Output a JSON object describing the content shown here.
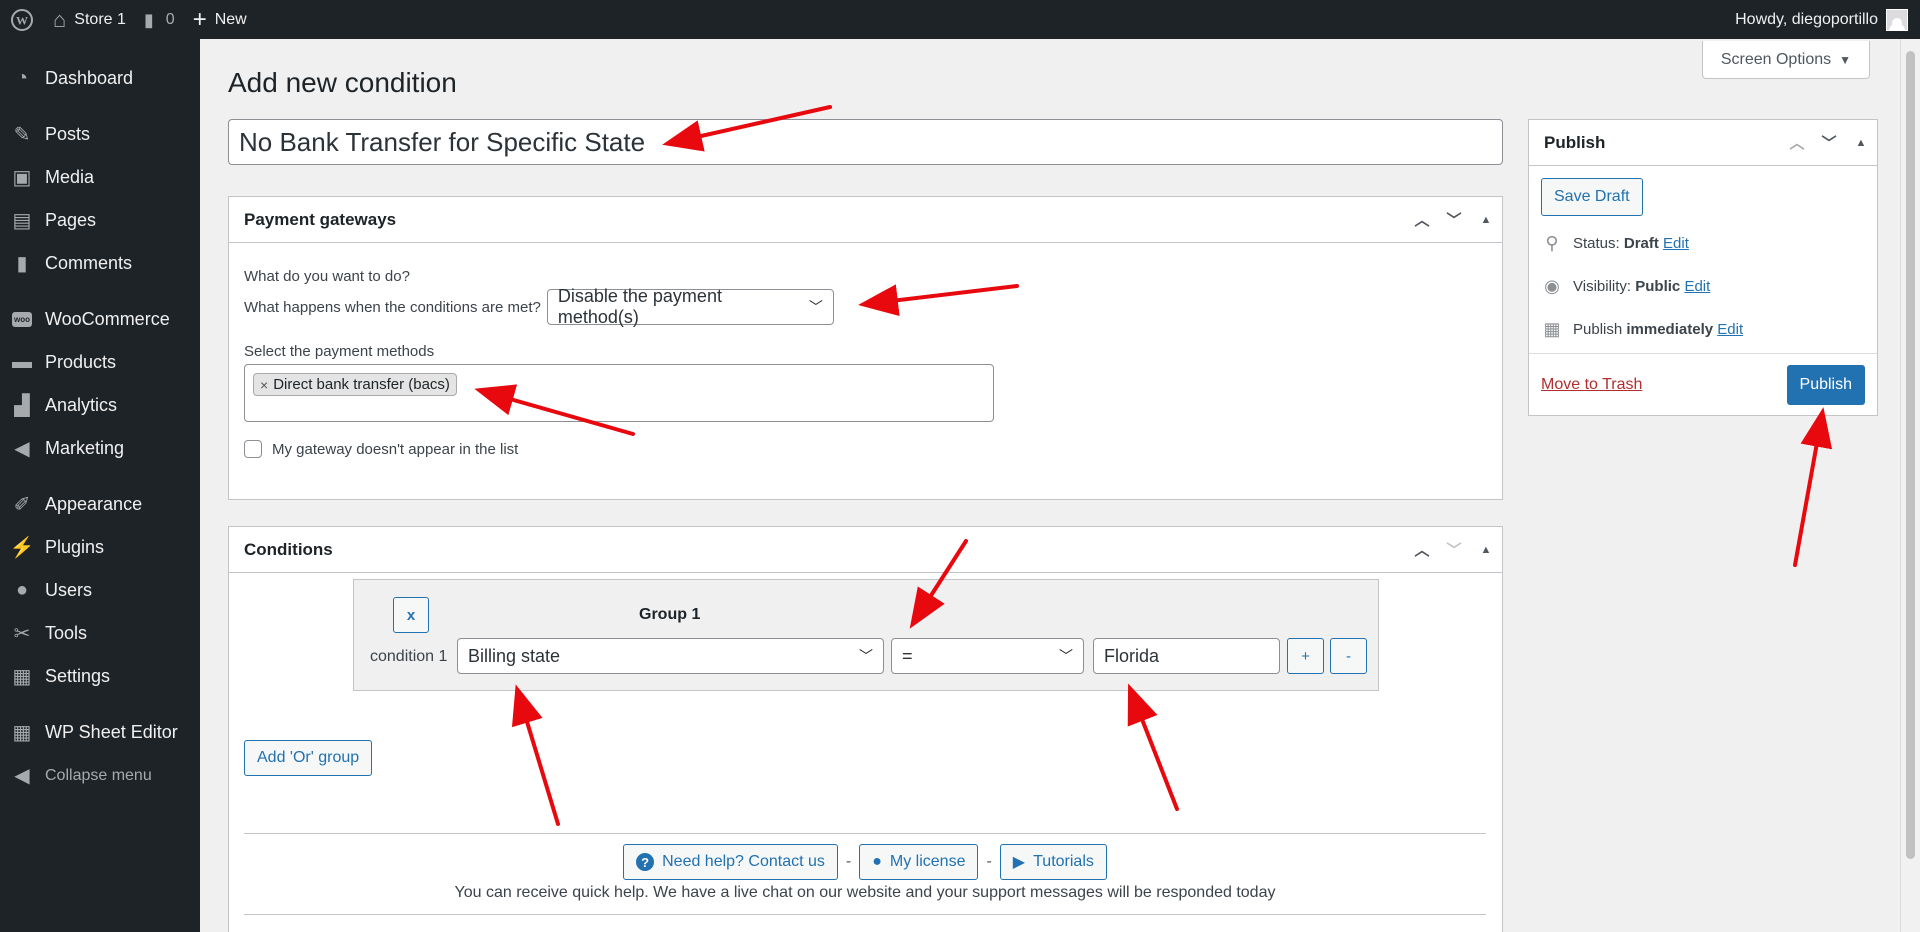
{
  "adminbar": {
    "site_name": "Store 1",
    "comments_count": "0",
    "new_label": "New",
    "howdy": "Howdy, diegoportillo"
  },
  "sidebar": {
    "items": [
      {
        "label": "Dashboard",
        "icon": "dashboard-icon"
      },
      {
        "label": "Posts",
        "icon": "pin-icon"
      },
      {
        "label": "Media",
        "icon": "media-icon"
      },
      {
        "label": "Pages",
        "icon": "pages-icon"
      },
      {
        "label": "Comments",
        "icon": "comments-icon"
      },
      {
        "label": "WooCommerce",
        "icon": "woo-icon"
      },
      {
        "label": "Products",
        "icon": "products-icon"
      },
      {
        "label": "Analytics",
        "icon": "analytics-icon"
      },
      {
        "label": "Marketing",
        "icon": "megaphone-icon"
      },
      {
        "label": "Appearance",
        "icon": "brush-icon"
      },
      {
        "label": "Plugins",
        "icon": "plugin-icon"
      },
      {
        "label": "Users",
        "icon": "user-icon"
      },
      {
        "label": "Tools",
        "icon": "wrench-icon"
      },
      {
        "label": "Settings",
        "icon": "settings-icon"
      },
      {
        "label": "WP Sheet Editor",
        "icon": "spreadsheet-icon"
      },
      {
        "label": "Collapse menu",
        "icon": "collapse-icon"
      }
    ]
  },
  "header": {
    "screen_options": "Screen Options",
    "page_title": "Add new condition"
  },
  "title_field": {
    "value": "No Bank Transfer for Specific State"
  },
  "payment_gateways": {
    "heading": "Payment gateways",
    "question": "What do you want to do?",
    "when_label": "What happens when the conditions are met?",
    "action_value": "Disable the payment method(s)",
    "select_label": "Select the payment methods",
    "token": "Direct bank transfer (bacs)",
    "checkbox_label": "My gateway doesn't appear in the list"
  },
  "conditions": {
    "heading": "Conditions",
    "group_title": "Group 1",
    "remove_group": "x",
    "condition_label": "condition 1",
    "field_value": "Billing state",
    "operator_value": "=",
    "value": "Florida",
    "plus": "+",
    "minus": "-",
    "add_or_group": "Add 'Or' group",
    "help_button": "Need help? Contact us",
    "license_button": "My license",
    "tutorials_button": "Tutorials",
    "separator": "-",
    "help_text": "You can receive quick help. We have a live chat on our website and your support messages will be responded today"
  },
  "publish": {
    "heading": "Publish",
    "save_draft": "Save Draft",
    "status_label": "Status: ",
    "status_value": "Draft",
    "visibility_label": "Visibility: ",
    "visibility_value": "Public",
    "publish_label": "Publish ",
    "publish_value": "immediately",
    "edit": "Edit",
    "move_to_trash": "Move to Trash",
    "publish_button": "Publish"
  },
  "colors": {
    "admin_dark": "#1d2327",
    "accent_blue": "#2271b1",
    "arrow_red": "#e8090f"
  }
}
